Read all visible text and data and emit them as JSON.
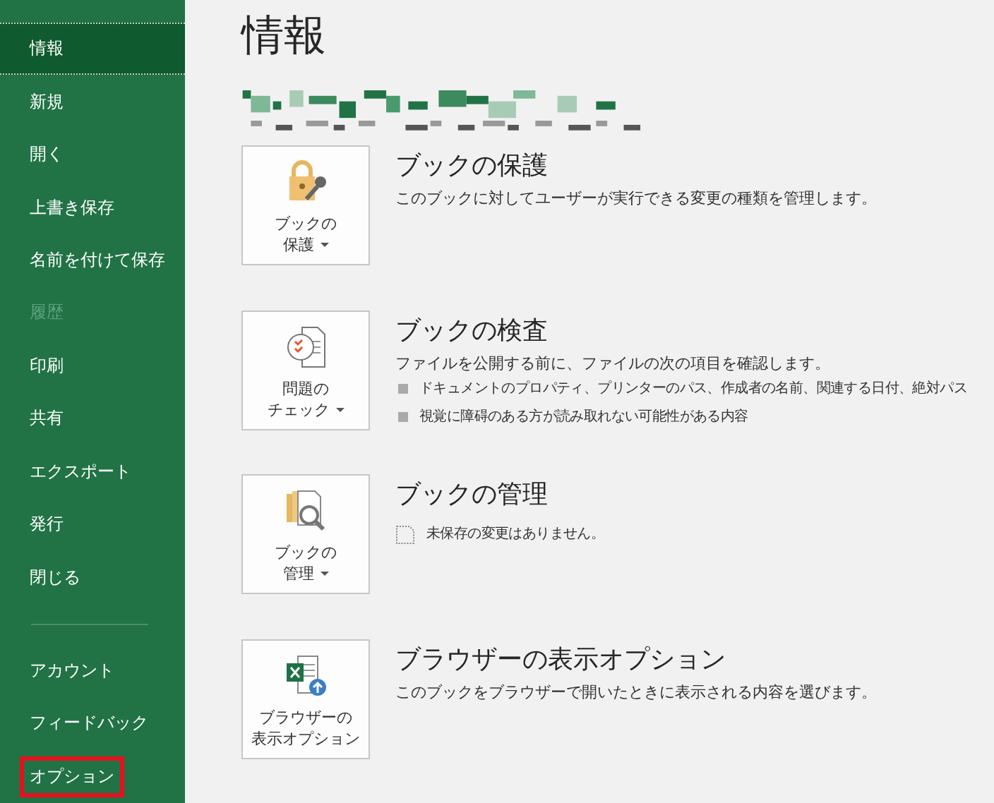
{
  "sidebar": {
    "items": [
      {
        "label": "情報",
        "selected": true,
        "disabled": false,
        "highlighted": false
      },
      {
        "label": "新規",
        "selected": false,
        "disabled": false,
        "highlighted": false
      },
      {
        "label": "開く",
        "selected": false,
        "disabled": false,
        "highlighted": false
      },
      {
        "label": "上書き保存",
        "selected": false,
        "disabled": false,
        "highlighted": false
      },
      {
        "label": "名前を付けて保存",
        "selected": false,
        "disabled": false,
        "highlighted": false
      },
      {
        "label": "履歴",
        "selected": false,
        "disabled": true,
        "highlighted": false
      },
      {
        "label": "印刷",
        "selected": false,
        "disabled": false,
        "highlighted": false
      },
      {
        "label": "共有",
        "selected": false,
        "disabled": false,
        "highlighted": false
      },
      {
        "label": "エクスポート",
        "selected": false,
        "disabled": false,
        "highlighted": false
      },
      {
        "label": "発行",
        "selected": false,
        "disabled": false,
        "highlighted": false
      },
      {
        "label": "閉じる",
        "selected": false,
        "disabled": false,
        "highlighted": false
      }
    ],
    "footer_items": [
      {
        "label": "アカウント",
        "selected": false,
        "disabled": false,
        "highlighted": false
      },
      {
        "label": "フィードバック",
        "selected": false,
        "disabled": false,
        "highlighted": false
      },
      {
        "label": "オプション",
        "selected": false,
        "disabled": false,
        "highlighted": true
      }
    ]
  },
  "page": {
    "title": "情報"
  },
  "sections": [
    {
      "kind": "protect",
      "button": {
        "lines": [
          "ブックの",
          "保護"
        ],
        "dropdown": true
      },
      "title": "ブックの保護",
      "description": "このブックに対してユーザーが実行できる変更の種類を管理します。"
    },
    {
      "kind": "inspect",
      "button": {
        "lines": [
          "問題の",
          "チェック"
        ],
        "dropdown": true
      },
      "title": "ブックの検査",
      "description": "ファイルを公開する前に、ファイルの次の項目を確認します。",
      "bullets": [
        "ドキュメントのプロパティ、プリンターのパス、作成者の名前、関連する日付、絶対パス",
        "視覚に障碍のある方が読み取れない可能性がある内容"
      ]
    },
    {
      "kind": "manage",
      "button": {
        "lines": [
          "ブックの",
          "管理"
        ],
        "dropdown": true
      },
      "title": "ブックの管理",
      "status": "未保存の変更はありません。"
    },
    {
      "kind": "browser",
      "button": {
        "lines": [
          "ブラウザーの",
          "表示オプション"
        ],
        "dropdown": false
      },
      "title": "ブラウザーの表示オプション",
      "description": "このブックをブラウザーで開いたときに表示される内容を選びます。"
    }
  ]
}
